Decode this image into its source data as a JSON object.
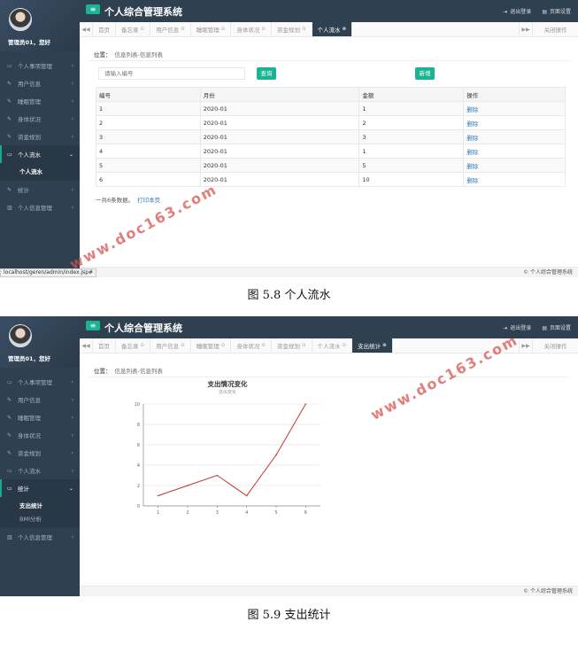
{
  "app": {
    "system_title": "个人综合管理系统",
    "greeting": "管理员01，您好",
    "logout": "退出登录",
    "page_settings": "页面设置",
    "close_ops": "关闭操作",
    "footer": "© 个人综合管理系统"
  },
  "shot1": {
    "nav": [
      {
        "label": "个人事项管理",
        "icon": "monitor-icon"
      },
      {
        "label": "用户信息",
        "icon": "edit-icon"
      },
      {
        "label": "睡眠管理",
        "icon": "edit-icon"
      },
      {
        "label": "身体状况",
        "icon": "edit-icon"
      },
      {
        "label": "资金规划",
        "icon": "edit-icon"
      },
      {
        "label": "个人流水",
        "icon": "monitor-icon",
        "active": true,
        "sub": [
          "个人流水"
        ]
      },
      {
        "label": "统计",
        "icon": "edit-icon"
      },
      {
        "label": "个人信息管理",
        "icon": "bars-icon"
      }
    ],
    "tabs": [
      "首页",
      "备忘录",
      "用户信息",
      "睡眠管理",
      "身体状况",
      "资金规划",
      "个人流水"
    ],
    "active_tab": "个人流水",
    "breadcrumb_label": "位置：",
    "breadcrumb": "信息列表-信息列表",
    "search_placeholder": "请输入编号",
    "search_btn": "查询",
    "add_btn": "新增",
    "table": {
      "headers": [
        "编号",
        "月份",
        "金额",
        "操作"
      ],
      "rows": [
        [
          "1",
          "2020-01",
          "1",
          "删除"
        ],
        [
          "2",
          "2020-01",
          "2",
          "删除"
        ],
        [
          "3",
          "2020-01",
          "3",
          "删除"
        ],
        [
          "4",
          "2020-01",
          "1",
          "删除"
        ],
        [
          "5",
          "2020-01",
          "5",
          "删除"
        ],
        [
          "6",
          "2020-01",
          "10",
          "删除"
        ]
      ]
    },
    "summary": "一共6条数据。",
    "print_link": "打印本页",
    "status_url": "localhost/geren/admin/index.jsp#"
  },
  "shot2": {
    "nav": [
      {
        "label": "个人事项管理",
        "icon": "monitor-icon"
      },
      {
        "label": "用户信息",
        "icon": "edit-icon"
      },
      {
        "label": "睡眠管理",
        "icon": "edit-icon"
      },
      {
        "label": "身体状况",
        "icon": "edit-icon"
      },
      {
        "label": "资金规划",
        "icon": "edit-icon"
      },
      {
        "label": "个人流水",
        "icon": "monitor-icon"
      },
      {
        "label": "统计",
        "icon": "monitor-icon",
        "active": true,
        "sub": [
          "支出统计",
          "BMI分析"
        ]
      },
      {
        "label": "个人信息管理",
        "icon": "bars-icon"
      }
    ],
    "tabs": [
      "首页",
      "备忘录",
      "用户信息",
      "睡眠管理",
      "身体状况",
      "资金规划",
      "个人流水",
      "支出统计"
    ],
    "active_tab": "支出统计",
    "breadcrumb_label": "位置：",
    "breadcrumb": "信息列表-信息列表"
  },
  "chart_data": {
    "type": "line",
    "title": "支出情况变化",
    "subtitle": "支出变化",
    "x": [
      "1",
      "2",
      "3",
      "4",
      "5",
      "6"
    ],
    "series": [
      {
        "values": [
          1,
          2,
          3,
          1,
          5,
          10
        ]
      }
    ],
    "yticks": [
      0,
      2,
      4,
      6,
      8,
      10
    ],
    "ylim": [
      0,
      10
    ],
    "grid": true,
    "line_color": "#c23531"
  },
  "captions": {
    "fig58": "图 5.8  个人流水",
    "fig59": "图 5.9  支出统计"
  },
  "watermark": "www.doc163.com"
}
